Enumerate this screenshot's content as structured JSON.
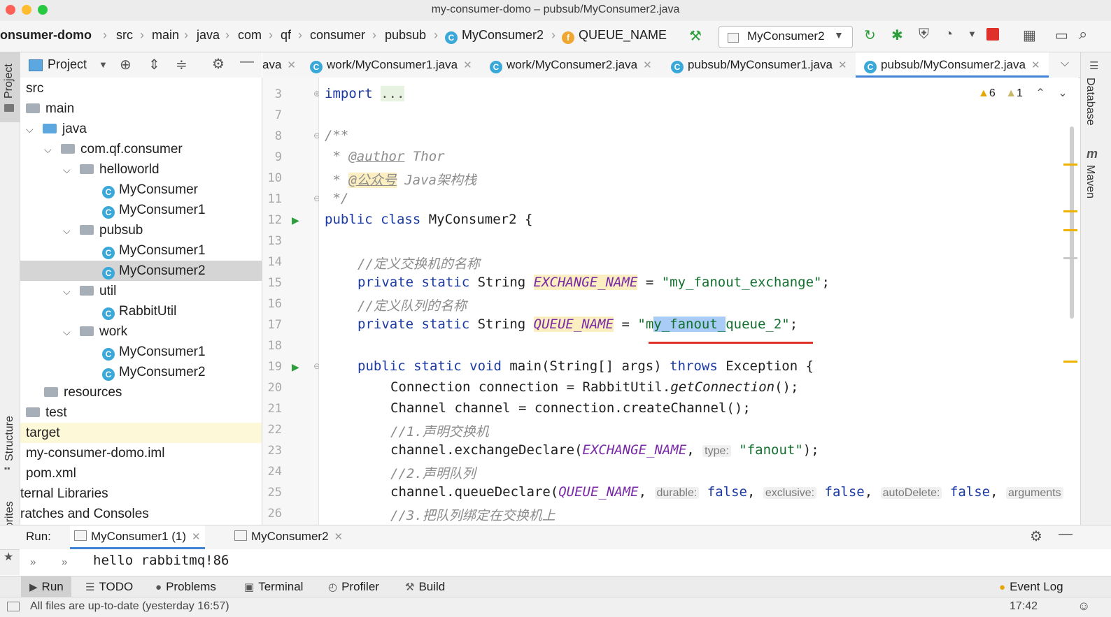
{
  "window": {
    "title": "my-consumer-domo – pubsub/MyConsumer2.java"
  },
  "breadcrumbs": [
    "onsumer-domo",
    "src",
    "main",
    "java",
    "com",
    "qf",
    "consumer",
    "pubsub",
    "MyConsumer2",
    "QUEUE_NAME"
  ],
  "run_config": "MyConsumer2",
  "project_panel": {
    "title": "Project",
    "tree": [
      "src",
      "main",
      "java",
      "com.qf.consumer",
      "helloworld",
      "MyConsumer",
      "MyConsumer1",
      "pubsub",
      "MyConsumer1",
      "MyConsumer2",
      "util",
      "RabbitUtil",
      "work",
      "MyConsumer1",
      "MyConsumer2",
      "resources",
      "test",
      "target",
      "my-consumer-domo.iml",
      "pom.xml",
      "ternal Libraries",
      "ratches and Consoles"
    ]
  },
  "editor_tabs": [
    "ava",
    "work/MyConsumer1.java",
    "work/MyConsumer2.java",
    "pubsub/MyConsumer1.java",
    "pubsub/MyConsumer2.java"
  ],
  "inspections": {
    "warnings": "6",
    "weak_warnings": "1"
  },
  "line_numbers": [
    "3",
    "7",
    "8",
    "9",
    "10",
    "11",
    "12",
    "13",
    "14",
    "15",
    "16",
    "17",
    "18",
    "19",
    "20",
    "21",
    "22",
    "23",
    "24",
    "25",
    "26"
  ],
  "code": {
    "l3_kw": "import",
    "l3_fold": "...",
    "l8": "/**",
    "l9_star": " * ",
    "l9_tag": "@author",
    "l9_val": " Thor",
    "l10_star": " * ",
    "l10_tag": "@公众号",
    "l10_val": " Java架构栈",
    "l11": " */",
    "l12_kw": "public class",
    "l12_name": " MyConsumer2 {",
    "l14": "//定义交换机的名称",
    "l15_kw": "private static",
    "l15_type": " String ",
    "l15_fld": "EXCHANGE_NAME",
    "l15_eq": " = ",
    "l15_str": "\"my_fanout_exchange\"",
    "l15_end": ";",
    "l16": "//定义队列的名称",
    "l17_kw": "private static",
    "l17_type": " String ",
    "l17_fld": "QUEUE_NAME",
    "l17_eq": " = ",
    "l17_q": "\"m",
    "l17_sel": "y_fanout_",
    "l17_rest": "queue_2\"",
    "l17_end": ";",
    "l19_kw": "public static void",
    "l19_main": " main(String[] args) ",
    "l19_throws": "throws",
    "l19_exc": " Exception {",
    "l20_a": "Connection connection = RabbitUtil.",
    "l20_b": "getConnection",
    "l20_c": "();",
    "l21": "Channel channel = connection.createChannel();",
    "l22": "//1.声明交换机",
    "l23_a": "channel.exchangeDeclare(",
    "l23_fld": "EXCHANGE_NAME",
    "l23_c": ", ",
    "l23_hint": "type:",
    "l23_str": " \"fanout\"",
    "l23_end": ");",
    "l24": "//2.声明队列",
    "l25_a": "channel.queueDeclare(",
    "l25_fld": "QUEUE_NAME",
    "l25_c1": ", ",
    "l25_h1": "durable:",
    "l25_v1": " false",
    "l25_c2": ", ",
    "l25_h2": "exclusive:",
    "l25_v2": " false",
    "l25_c3": ", ",
    "l25_h3": "autoDelete:",
    "l25_v3": " false",
    "l25_c4": ", ",
    "l25_h4": "arguments",
    "l26": "//3.把队列绑定在交换机上"
  },
  "run_panel": {
    "label": "Run:",
    "tabs": [
      "MyConsumer1 (1)",
      "MyConsumer2"
    ],
    "output": "hello rabbitmq!86"
  },
  "tool_windows": [
    "Run",
    "TODO",
    "Problems",
    "Terminal",
    "Profiler",
    "Build",
    "Event Log"
  ],
  "side_labels": {
    "project": "Project",
    "structure": "Structure",
    "favorites": "Favorites",
    "database": "Database",
    "maven": "Maven"
  },
  "status": {
    "message": "All files are up-to-date (yesterday 16:57)",
    "time": "17:42"
  },
  "colors": {
    "accent": "#3f82d6",
    "keyword": "#1b3aa3",
    "string": "#136f2e",
    "field": "#7a2aa8",
    "underline": "#e0302a"
  }
}
